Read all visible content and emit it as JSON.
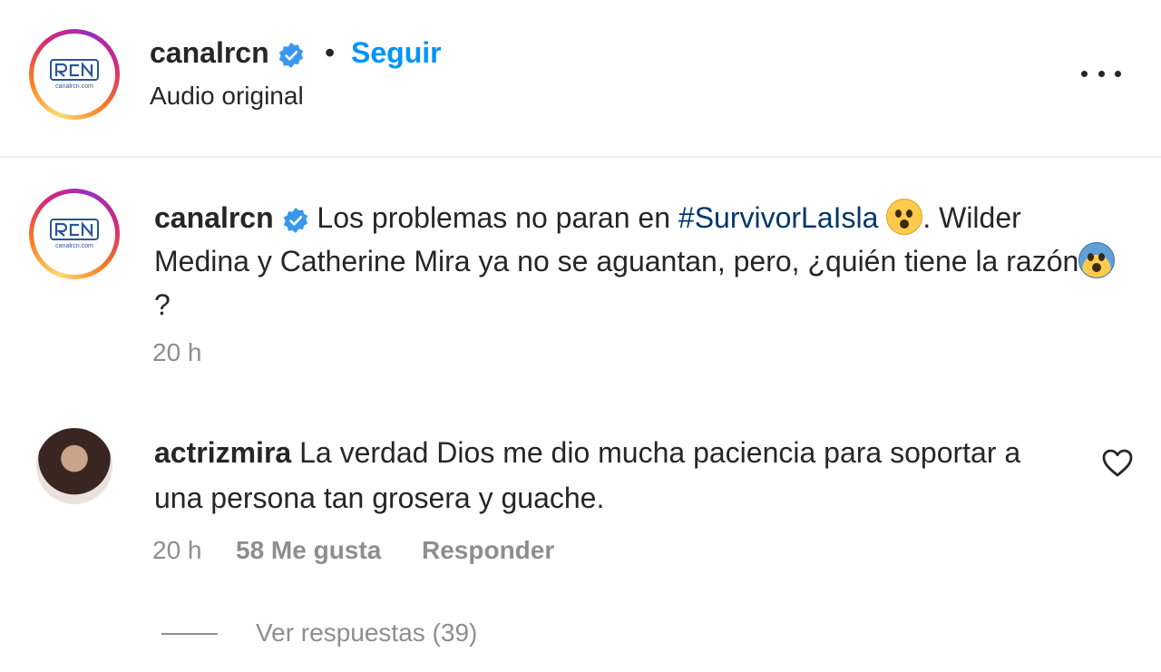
{
  "header": {
    "username": "canalrcn",
    "separator": "•",
    "follow_label": "Seguir",
    "audio_label": "Audio original"
  },
  "logo": {
    "text": "canalrcn.com"
  },
  "caption": {
    "username": "canalrcn",
    "text_1": "Los problemas no paran en ",
    "hashtag": "#SurvivorLaIsla",
    "text_2": ". Wilder Medina y Catherine Mira ya no se aguantan, pero, ¿quién tiene la razón",
    "text_3": "?",
    "time": "20 h",
    "emoji_1": "flushed-face-emoji",
    "emoji_2": "fearful-face-emoji"
  },
  "comment": {
    "username": "actrizmira",
    "text": "La verdad Dios me dio mucha paciencia para soportar a una persona tan grosera y guache.",
    "time": "20 h",
    "likes": "58 Me gusta",
    "reply_label": "Responder",
    "view_replies": "Ver respuestas (39)"
  },
  "colors": {
    "link_blue": "#0095f6",
    "hashtag": "#00376b",
    "verified": "#3897f0",
    "muted": "#8e8e8e"
  }
}
